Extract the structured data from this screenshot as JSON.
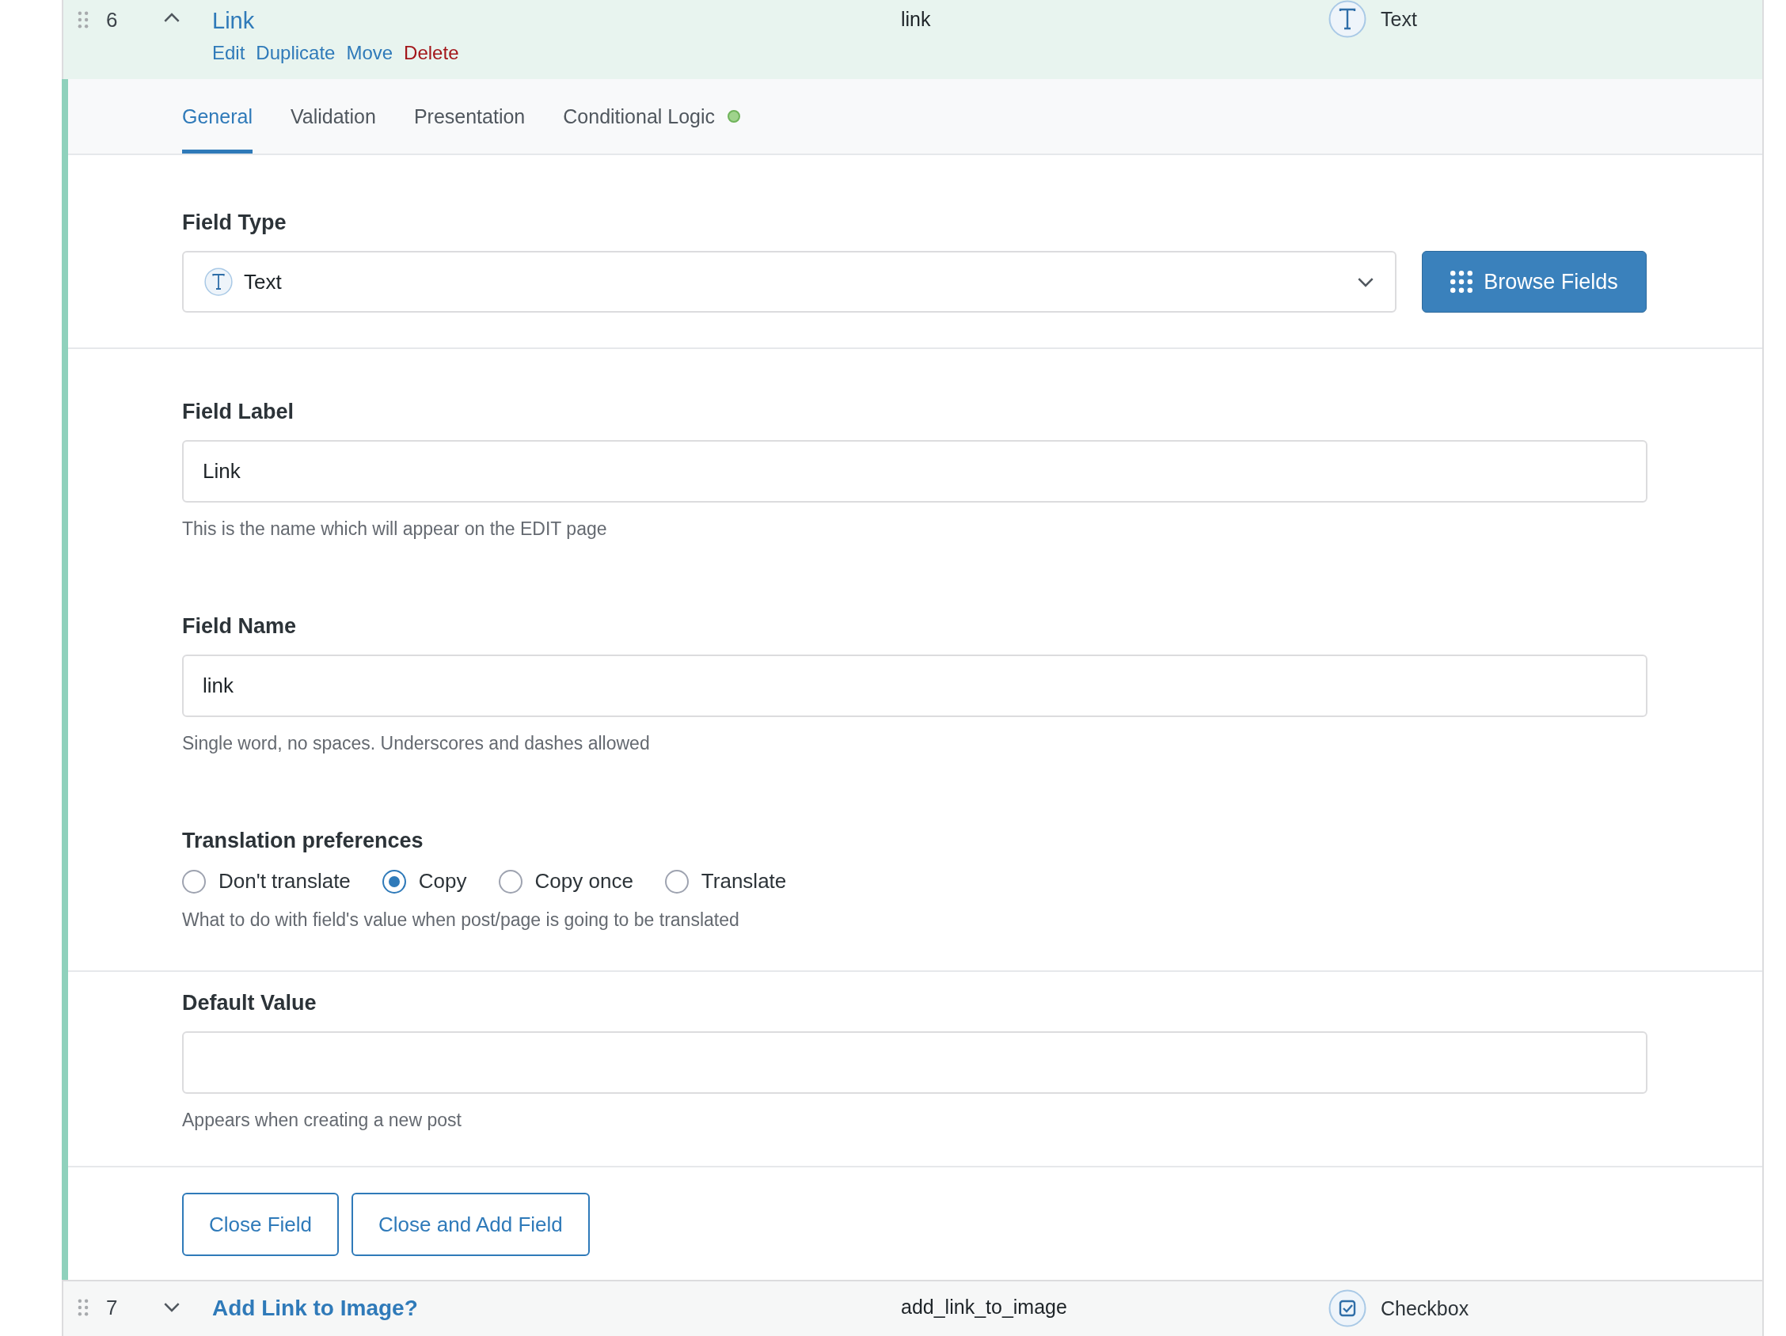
{
  "open_field": {
    "number": "6",
    "expanded": true,
    "title": "Link",
    "actions": [
      {
        "label": "Edit",
        "kind": "link"
      },
      {
        "label": "Duplicate",
        "kind": "link"
      },
      {
        "label": "Move",
        "kind": "link"
      },
      {
        "label": "Delete",
        "kind": "danger"
      }
    ],
    "name": "link",
    "type": "Text"
  },
  "tabs": [
    {
      "label": "General",
      "selected": true,
      "indicator": false
    },
    {
      "label": "Validation",
      "selected": false,
      "indicator": false
    },
    {
      "label": "Presentation",
      "selected": false,
      "indicator": false
    },
    {
      "label": "Conditional Logic",
      "selected": false,
      "indicator": true
    }
  ],
  "sections": [
    {
      "kind": "select",
      "label": "Field Type",
      "value": "Text",
      "button": "Browse Fields"
    },
    {
      "kind": "input",
      "label": "Field Label",
      "value": "Link",
      "help": "This is the name which will appear on the EDIT page"
    },
    {
      "kind": "input",
      "label": "Field Name",
      "value": "link",
      "help": "Single word, no spaces. Underscores and dashes allowed"
    },
    {
      "kind": "radios",
      "label": "Translation preferences",
      "options": [
        {
          "label": "Don't translate",
          "selected": false
        },
        {
          "label": "Copy",
          "selected": true
        },
        {
          "label": "Copy once",
          "selected": false
        },
        {
          "label": "Translate",
          "selected": false
        }
      ],
      "help": "What to do with field's value when post/page is going to be translated"
    },
    {
      "kind": "input",
      "label": "Default Value",
      "help": "Appears when creating a new post"
    }
  ],
  "footer_buttons": [
    "Close Field",
    "Close and Add Field"
  ],
  "next_field": {
    "number": "7",
    "expanded": false,
    "title": "Add Link to Image?",
    "name": "add_link_to_image",
    "type": "Checkbox"
  }
}
